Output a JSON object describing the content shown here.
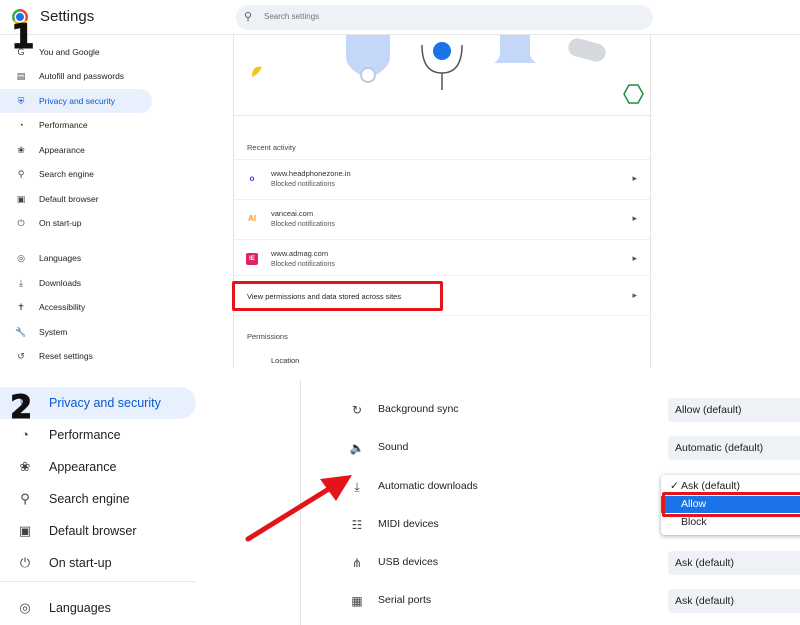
{
  "panel1": {
    "badge": "1",
    "title": "Settings",
    "search_placeholder": "Search settings",
    "nav": [
      {
        "label": "You and Google",
        "icon": "google-account-icon"
      },
      {
        "label": "Autofill and passwords",
        "icon": "clipboard-icon"
      },
      {
        "label": "Privacy and security",
        "icon": "shield-icon",
        "active": true
      },
      {
        "label": "Performance",
        "icon": "speedometer-icon"
      },
      {
        "label": "Appearance",
        "icon": "palette-icon"
      },
      {
        "label": "Search engine",
        "icon": "search-icon"
      },
      {
        "label": "Default browser",
        "icon": "browser-window-icon"
      },
      {
        "label": "On start-up",
        "icon": "power-icon"
      },
      {
        "label": "Languages",
        "icon": "globe-icon"
      },
      {
        "label": "Downloads",
        "icon": "download-icon"
      },
      {
        "label": "Accessibility",
        "icon": "accessibility-icon"
      },
      {
        "label": "System",
        "icon": "wrench-icon"
      },
      {
        "label": "Reset settings",
        "icon": "reset-history-icon"
      }
    ],
    "recent_activity_title": "Recent activity",
    "sites": [
      {
        "name": "www.headphonezone.in",
        "status": "Blocked notifications",
        "favicon": "o",
        "favicon_color": "#5b2bd6"
      },
      {
        "name": "vanceai.com",
        "status": "Blocked notifications",
        "favicon": "AI",
        "favicon_color": "#f29b1d"
      },
      {
        "name": "www.admag.com",
        "status": "Blocked notifications",
        "favicon": "IE",
        "favicon_color": "#e0245e"
      }
    ],
    "view_permissions_label": "View permissions and data stored across sites",
    "permissions_title": "Permissions",
    "location_label": "Location"
  },
  "panel2": {
    "badge": "2",
    "nav": [
      {
        "label": "Privacy and security",
        "icon": "shield-icon",
        "active": true
      },
      {
        "label": "Performance",
        "icon": "speedometer-icon"
      },
      {
        "label": "Appearance",
        "icon": "palette-icon"
      },
      {
        "label": "Search engine",
        "icon": "search-icon"
      },
      {
        "label": "Default browser",
        "icon": "browser-window-icon"
      },
      {
        "label": "On start-up",
        "icon": "power-icon"
      },
      {
        "label": "Languages",
        "icon": "globe-icon"
      }
    ],
    "rows": [
      {
        "label": "Background sync",
        "icon": "sync-icon",
        "value": "Allow (default)"
      },
      {
        "label": "Sound",
        "icon": "speaker-icon",
        "value": "Automatic (default)"
      },
      {
        "label": "Automatic downloads",
        "icon": "download-icon",
        "value": "Ask (default)"
      },
      {
        "label": "MIDI devices",
        "icon": "piano-keys-icon",
        "value": ""
      },
      {
        "label": "USB devices",
        "icon": "usb-icon",
        "value": "Ask (default)"
      },
      {
        "label": "Serial ports",
        "icon": "serial-port-icon",
        "value": "Ask (default)"
      }
    ],
    "dropdown_options": [
      {
        "label": "Ask (default)",
        "checked": true
      },
      {
        "label": "Allow",
        "selected": true
      },
      {
        "label": "Block"
      }
    ]
  },
  "colors": {
    "accent": "#0b57d0",
    "active_bg": "#e8f0fe",
    "highlight_red": "#e3151b",
    "selected_option": "#1a73e8"
  }
}
